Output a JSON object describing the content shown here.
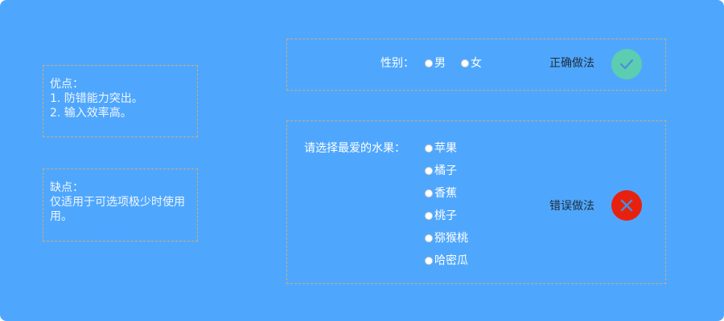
{
  "pros": {
    "title": "优点：",
    "lines": [
      "1. 防错能力突出。",
      "2. 输入效率高。"
    ]
  },
  "cons": {
    "title": "缺点：",
    "lines": [
      "仅适用于可选项极少时使",
      "用。"
    ],
    "last_char": "用"
  },
  "correct_example": {
    "field_label": "性别：",
    "options": [
      "男",
      "女"
    ],
    "verdict": "正确做法",
    "icon": "check-icon",
    "icon_color": "#5ccdb0"
  },
  "wrong_example": {
    "field_label": "请选择最爱的水果：",
    "options": [
      "苹果",
      "橘子",
      "香蕉",
      "桃子",
      "猕猴桃",
      "哈密瓜"
    ],
    "verdict": "错误做法",
    "icon": "close-icon",
    "icon_color": "#e8210f"
  },
  "colors": {
    "background": "#4fa7fd",
    "dashed_border": "#c9ad7e",
    "correct": "#5ccdb0",
    "wrong": "#e8210f"
  }
}
